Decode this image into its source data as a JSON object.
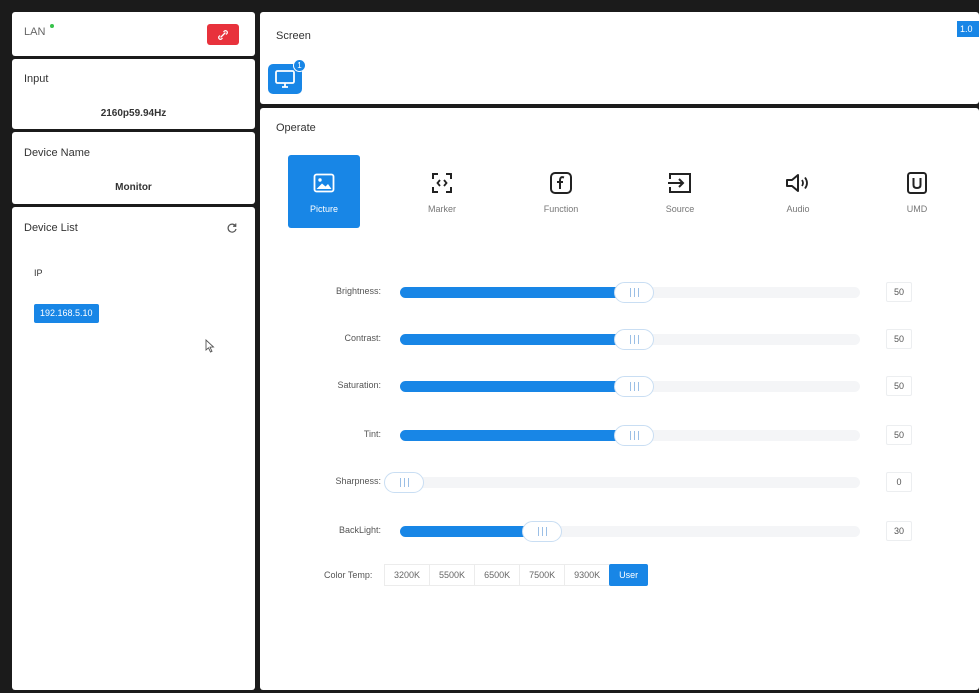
{
  "lan": {
    "label": "LAN"
  },
  "input": {
    "title": "Input",
    "value": "2160p59.94Hz"
  },
  "device": {
    "title": "Device Name",
    "value": "Monitor"
  },
  "device_list": {
    "title": "Device List",
    "ip_label": "IP",
    "items": [
      "192.168.5.10"
    ]
  },
  "screen": {
    "title": "Screen",
    "badge": "1",
    "version": "1.0"
  },
  "operate": {
    "title": "Operate",
    "tabs": [
      {
        "label": "Picture",
        "icon": "picture-icon",
        "active": true
      },
      {
        "label": "Marker",
        "icon": "marker-icon",
        "active": false
      },
      {
        "label": "Function",
        "icon": "function-icon",
        "active": false
      },
      {
        "label": "Source",
        "icon": "source-icon",
        "active": false
      },
      {
        "label": "Audio",
        "icon": "audio-icon",
        "active": false
      },
      {
        "label": "UMD",
        "icon": "umd-icon",
        "active": false
      }
    ]
  },
  "picture": {
    "sliders": [
      {
        "label": "Brightness:",
        "value": "50",
        "max": 100
      },
      {
        "label": "Contrast:",
        "value": "50",
        "max": 100
      },
      {
        "label": "Saturation:",
        "value": "50",
        "max": 100
      },
      {
        "label": "Tint:",
        "value": "50",
        "max": 100
      },
      {
        "label": "Sharpness:",
        "value": "0",
        "max": 100
      },
      {
        "label": "BackLight:",
        "value": "30",
        "max": 100
      }
    ],
    "color_temp": {
      "label": "Color Temp:",
      "options": [
        "3200K",
        "5500K",
        "6500K",
        "7500K",
        "9300K",
        "User"
      ],
      "selected": "User"
    }
  },
  "colors": {
    "accent": "#1886e6",
    "danger": "#e8323c",
    "lan_status": "#36c24a"
  }
}
